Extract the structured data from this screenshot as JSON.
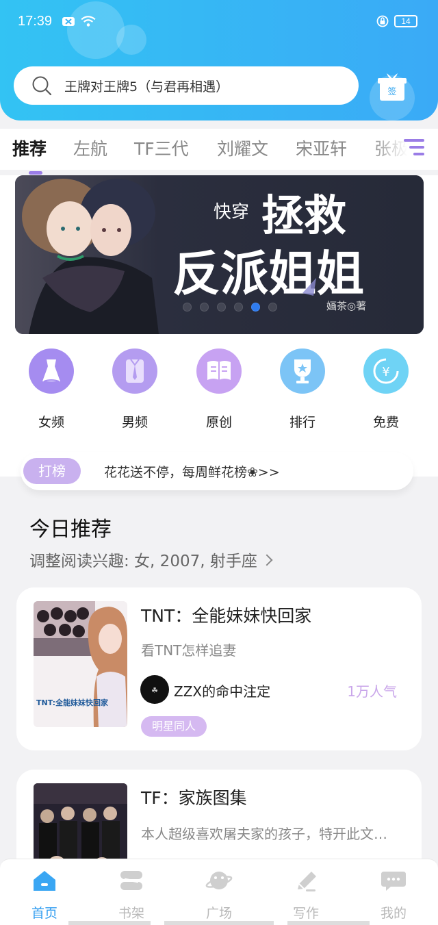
{
  "status_bar": {
    "time": "17:39",
    "battery": "14"
  },
  "search": {
    "text": "王牌对王牌5（与君再相遇）"
  },
  "sign_in": {
    "label": "签"
  },
  "tabs": [
    {
      "label": "推荐"
    },
    {
      "label": "左航"
    },
    {
      "label": "TF三代"
    },
    {
      "label": "刘耀文"
    },
    {
      "label": "宋亚轩"
    },
    {
      "label": "张极"
    }
  ],
  "banner": {
    "small_title": "快穿",
    "title_line1": "拯救",
    "title_line2": "反派姐姐",
    "author": "婳茶◎著",
    "dots_count": 6,
    "active_dot": 4
  },
  "categories": [
    {
      "label": "女频",
      "icon": "dress-icon",
      "color": "#a58cf0"
    },
    {
      "label": "男频",
      "icon": "shirt-icon",
      "color": "#b49cf0"
    },
    {
      "label": "原创",
      "icon": "book-icon",
      "color": "#c7a2f2"
    },
    {
      "label": "排行",
      "icon": "trophy-icon",
      "color": "#7cc4f6"
    },
    {
      "label": "免费",
      "icon": "yuan-icon",
      "color": "#6fd3f5"
    }
  ],
  "notice": {
    "tag": "打榜",
    "text": "花花送不停，每周鲜花榜❀>>"
  },
  "today": {
    "title": "今日推荐",
    "subtitle": "调整阅读兴趣: 女, 2007, 射手座"
  },
  "books": [
    {
      "title": "TNT：全能妹妹快回家",
      "desc": "看TNT怎样追妻",
      "author": "ZZX的命中注定",
      "popularity": "1万人气",
      "tag": "明星同人",
      "cover_text": "TNT:全能妹妹快回家"
    },
    {
      "title": "TF：家族图集",
      "desc": "本人超级喜欢屠夫家的孩子，特开此文…"
    }
  ],
  "bottom_nav": [
    {
      "label": "首页",
      "icon": "home-icon"
    },
    {
      "label": "书架",
      "icon": "bookshelf-icon"
    },
    {
      "label": "广场",
      "icon": "planet-icon"
    },
    {
      "label": "写作",
      "icon": "pen-icon"
    },
    {
      "label": "我的",
      "icon": "chat-icon"
    }
  ],
  "colors": {
    "header": "#3aaaf6",
    "accent_purple": "#9a7ce6",
    "nav_active": "#2f9cf0"
  }
}
